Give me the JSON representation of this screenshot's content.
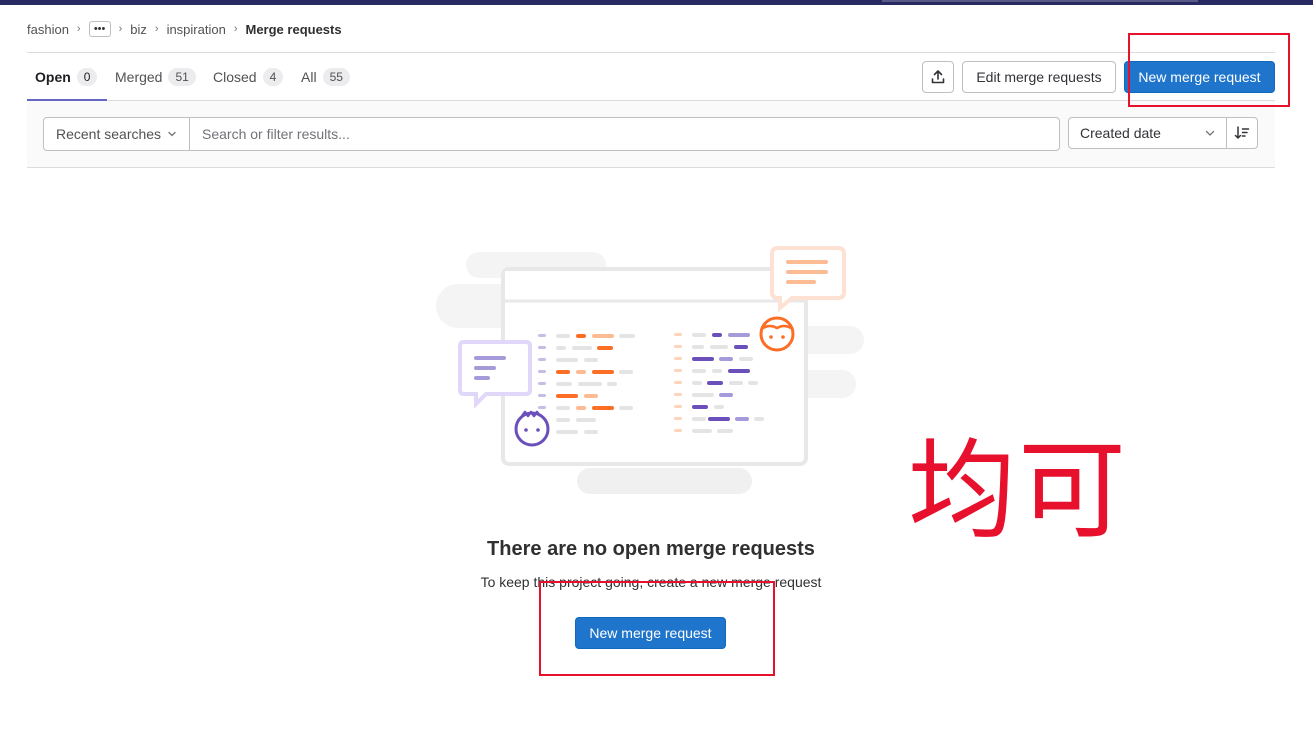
{
  "breadcrumb": {
    "items": [
      "fashion",
      "biz",
      "inspiration"
    ],
    "ellipsis": "•••",
    "current": "Merge requests"
  },
  "tabs": [
    {
      "label": "Open",
      "count": "0",
      "active": true
    },
    {
      "label": "Merged",
      "count": "51",
      "active": false
    },
    {
      "label": "Closed",
      "count": "4",
      "active": false
    },
    {
      "label": "All",
      "count": "55",
      "active": false
    }
  ],
  "toolbar": {
    "export_icon": "upload-icon",
    "edit_label": "Edit merge requests",
    "new_label": "New merge request"
  },
  "filter": {
    "recent_label": "Recent searches",
    "search_placeholder": "Search or filter results...",
    "sort_label": "Created date",
    "sort_direction_icon": "sort-lowest-icon"
  },
  "empty_state": {
    "title": "There are no open merge requests",
    "description": "To keep this project going, create a new merge request",
    "button_label": "New merge request"
  },
  "annotation": {
    "text": "均可",
    "color": "#e8112d"
  },
  "colors": {
    "primary": "#1f75cb",
    "topbar": "#292961",
    "tab_accent": "#6666c4",
    "illustration_orange": "#fc6d26",
    "illustration_purple": "#6b4fbb"
  }
}
